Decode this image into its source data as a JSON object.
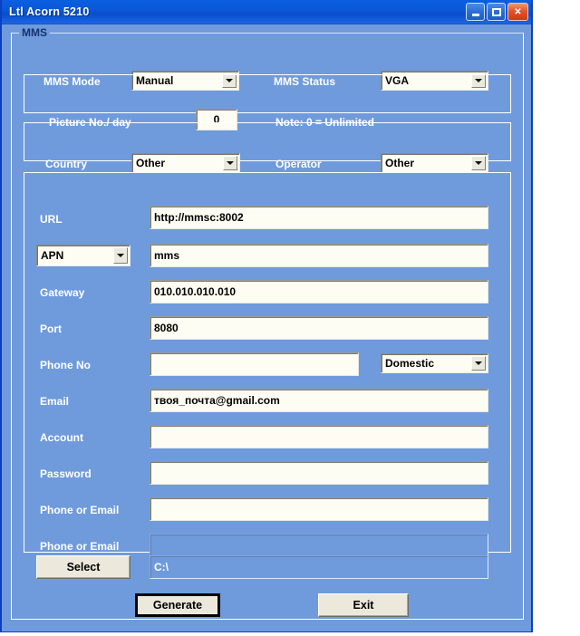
{
  "window": {
    "title": "Ltl Acorn 5210",
    "buttons": {
      "minimize": "minimize",
      "maximize": "maximize",
      "close": "✕"
    }
  },
  "group": {
    "mms_title": "MMS"
  },
  "mms": {
    "mode_label": "MMS Mode",
    "mode_value": "Manual",
    "status_label": "MMS Status",
    "status_value": "VGA",
    "picture_label": "Picture No./ day",
    "picture_value": "0",
    "note": "Note: 0 = Unlimited",
    "country_label": "Country",
    "country_value": "Other",
    "operator_label": "Operator",
    "operator_value": "Other"
  },
  "settings": {
    "url_label": "URL",
    "url_value": "http://mmsc:8002",
    "apn_label": "APN",
    "apn_value": "mms",
    "gateway_label": "Gateway",
    "gateway_value": "010.010.010.010",
    "port_label": "Port",
    "port_value": "8080",
    "phone_label": "Phone No",
    "phone_value": "",
    "phone_type_value": "Domestic",
    "email_label": "Email",
    "email_value": "твоя_почта@gmail.com",
    "account_label": "Account",
    "account_value": "",
    "password_label": "Password",
    "password_value": "",
    "phone_or_email1_label": "Phone or Email",
    "phone_or_email1_value": "",
    "phone_or_email2_label": "Phone or Email",
    "phone_or_email2_value": ""
  },
  "footer": {
    "select_label": "Select",
    "path_value": "C:\\",
    "generate_label": "Generate",
    "exit_label": "Exit"
  },
  "colors": {
    "window_bg": "#6f9bdd",
    "titlebar": "#0a58d8",
    "label_text": "#ffffff",
    "group_title": "#17326c",
    "field_bg": "#fdfdf4",
    "button_face": "#ece9dc",
    "close_btn": "#e2562a"
  }
}
